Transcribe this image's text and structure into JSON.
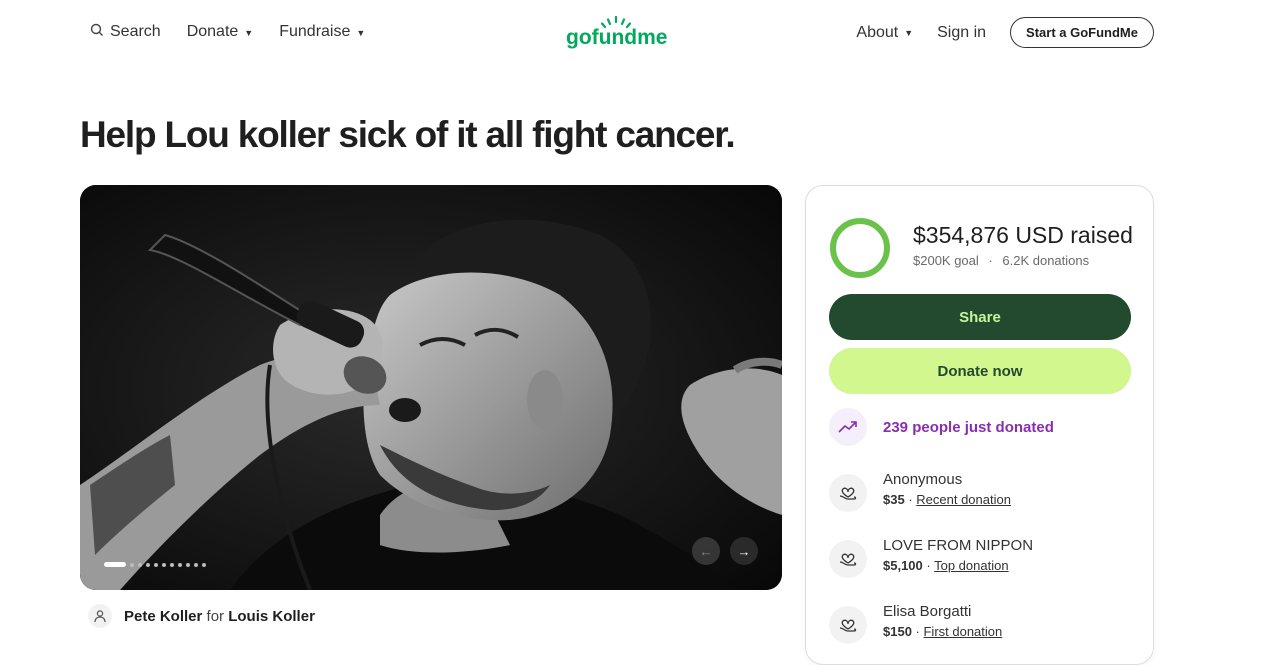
{
  "nav": {
    "search_label": "Search",
    "donate_label": "Donate",
    "fundraise_label": "Fundraise",
    "logo_text": "gofundme",
    "about_label": "About",
    "signin_label": "Sign in",
    "start_label": "Start a GoFundMe"
  },
  "campaign": {
    "title": "Help Lou koller sick of it all fight cancer.",
    "organizer": "Pete Koller",
    "for_word": "for",
    "beneficiary": "Louis Koller",
    "gallery_slide_index": 1,
    "gallery_slide_count": 11
  },
  "stats": {
    "raised": "$354,876 USD raised",
    "goal": "$200K goal",
    "separator": "·",
    "donations": "6.2K donations",
    "progress_fraction": 1.0
  },
  "actions": {
    "share_label": "Share",
    "donate_label": "Donate now"
  },
  "trend": {
    "text": "239 people just donated"
  },
  "donors": [
    {
      "name": "Anonymous",
      "amount": "$35",
      "sep": " · ",
      "tag": "Recent donation"
    },
    {
      "name": "LOVE FROM NIPPON",
      "amount": "$5,100",
      "sep": " · ",
      "tag": "Top donation"
    },
    {
      "name": "Elisa Borgatti",
      "amount": "$150",
      "sep": " · ",
      "tag": "First donation"
    }
  ],
  "colors": {
    "brand_green": "#02a95c",
    "dark_green": "#234a2e",
    "lime": "#d2f78e",
    "purple": "#8a2eb0"
  },
  "icons": {
    "search": "search-icon",
    "trend": "trend-up-icon",
    "donor": "heart-hand-icon",
    "user": "user-icon"
  }
}
